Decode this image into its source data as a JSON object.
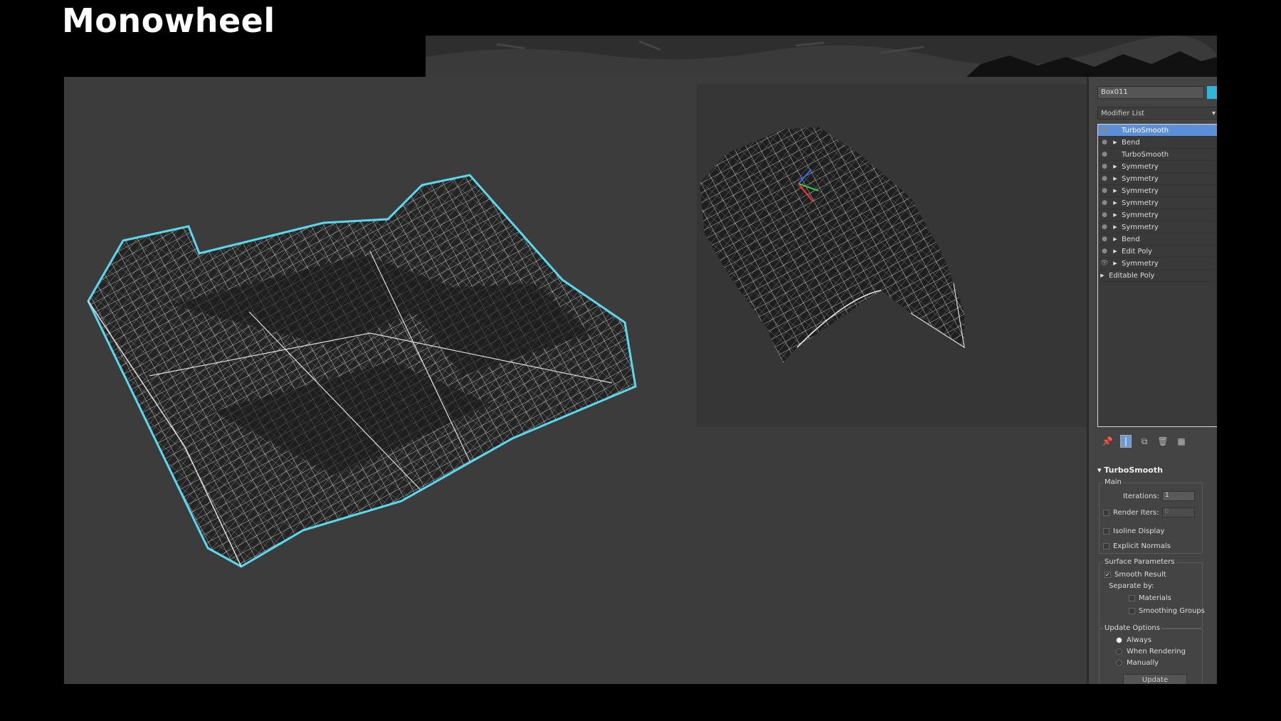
{
  "title": "Monowheel",
  "panel": {
    "object_name": "Box011",
    "accent_color": "#2fb6d8",
    "modifier_list_label": "Modifier List",
    "stack": [
      {
        "label": "TurboSmooth",
        "selected": true,
        "arrow": false
      },
      {
        "label": "Bend",
        "selected": false,
        "arrow": true
      },
      {
        "label": "TurboSmooth",
        "selected": false,
        "arrow": false
      },
      {
        "label": "Symmetry",
        "selected": false,
        "arrow": true
      },
      {
        "label": "Symmetry",
        "selected": false,
        "arrow": true
      },
      {
        "label": "Symmetry",
        "selected": false,
        "arrow": true
      },
      {
        "label": "Symmetry",
        "selected": false,
        "arrow": true
      },
      {
        "label": "Symmetry",
        "selected": false,
        "arrow": true
      },
      {
        "label": "Symmetry",
        "selected": false,
        "arrow": true
      },
      {
        "label": "Bend",
        "selected": false,
        "arrow": true
      },
      {
        "label": "Edit Poly",
        "selected": false,
        "arrow": true
      },
      {
        "label": "Symmetry",
        "selected": false,
        "arrow": true,
        "eye": true
      },
      {
        "label": "Editable Poly",
        "selected": false,
        "arrow": true,
        "root": true
      }
    ],
    "rollout": {
      "title": "TurboSmooth",
      "main_label": "Main",
      "iterations_label": "Iterations:",
      "iterations_value": "1",
      "render_iters_label": "Render Iters:",
      "render_iters_value": "0",
      "isoline_label": "Isoline Display",
      "explicit_normals_label": "Explicit Normals",
      "surface_label": "Surface Parameters",
      "smooth_result_label": "Smooth Result",
      "separate_by_label": "Separate by:",
      "materials_label": "Materials",
      "smoothing_groups_label": "Smoothing Groups",
      "update_options_label": "Update Options",
      "always_label": "Always",
      "when_rendering_label": "When Rendering",
      "manually_label": "Manually",
      "update_button_label": "Update"
    }
  },
  "icons": [
    "pin-icon",
    "show-end-result-icon",
    "make-unique-icon",
    "remove-modifier-icon",
    "configure-sets-icon"
  ]
}
